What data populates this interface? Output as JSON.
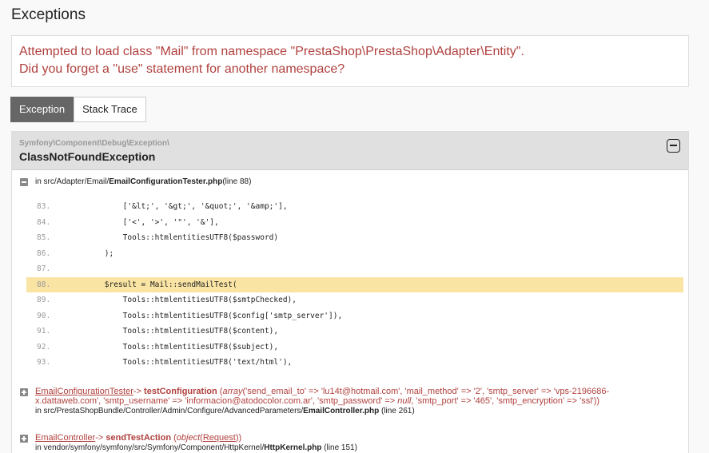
{
  "page": {
    "title": "Exceptions"
  },
  "message": {
    "line1": "Attempted to load class \"Mail\" from namespace \"PrestaShop\\PrestaShop\\Adapter\\Entity\".",
    "line2": "Did you forget a \"use\" statement for another namespace?"
  },
  "tabs": [
    {
      "label": "Exception",
      "active": true
    },
    {
      "label": "Stack Trace",
      "active": false
    }
  ],
  "trace": {
    "namespace": "Symfony\\Component\\Debug\\Exception\\",
    "class_name": "ClassNotFoundException",
    "collapse_icon": "minus-square-icon",
    "location": {
      "prefix": "in src/Adapter/Email/",
      "file": "EmailConfigurationTester.php",
      "suffix": " (line 88)"
    },
    "code_lines": [
      {
        "num": "83.",
        "text": "            ['&lt;', '&gt;', '&quot;', '&amp;'],",
        "highlight": false
      },
      {
        "num": "84.",
        "text": "            ['<', '>', '\"', '&'],",
        "highlight": false
      },
      {
        "num": "85.",
        "text": "            Tools::htmlentitiesUTF8($password)",
        "highlight": false
      },
      {
        "num": "86.",
        "text": "        );",
        "highlight": false
      },
      {
        "num": "87.",
        "text": "",
        "highlight": false
      },
      {
        "num": "88.",
        "text": "        $result = Mail::sendMailTest(",
        "highlight": true
      },
      {
        "num": "89.",
        "text": "            Tools::htmlentitiesUTF8($smtpChecked),",
        "highlight": false
      },
      {
        "num": "90.",
        "text": "            Tools::htmlentitiesUTF8($config['smtp_server']),",
        "highlight": false
      },
      {
        "num": "91.",
        "text": "            Tools::htmlentitiesUTF8($content),",
        "highlight": false
      },
      {
        "num": "92.",
        "text": "            Tools::htmlentitiesUTF8($subject),",
        "highlight": false
      },
      {
        "num": "93.",
        "text": "            Tools::htmlentitiesUTF8('text/html'),",
        "highlight": false
      }
    ],
    "frames": [
      {
        "class": "EmailConfigurationTester",
        "arrow": "->",
        "function": "testConfiguration",
        "args_line1": "(array('send_email_to' => 'lu14t@hotmail.com', 'mail_method' => '2', 'smtp_server' => 'vps-2196686-",
        "args_line2": "x.dattaweb.com', 'smtp_username' => 'informacion@atodocolor.com.ar', 'smtp_password' => null, 'smtp_port' => '465', 'smtp_encryption' => 'ssl'))",
        "loc_prefix": "in src/PrestaShopBundle/Controller/Admin/Configure/AdvancedParameters/",
        "loc_file": "EmailController.php",
        "loc_suffix": " (line 261)"
      },
      {
        "class": "EmailController",
        "arrow": "->",
        "function": "sendTestAction",
        "args_line1": "(object(Request))",
        "loc_prefix": "in vendor/symfony/symfony/src/Symfony/Component/HttpKernel/",
        "loc_file": "HttpKernel.php",
        "loc_suffix": " (line 151)"
      }
    ]
  }
}
